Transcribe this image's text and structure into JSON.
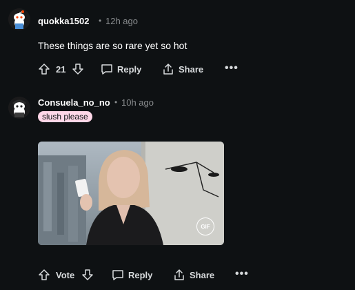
{
  "comments": [
    {
      "username": "quokka1502",
      "dot": "•",
      "timestamp": "12h ago",
      "text": "These things are so rare yet so hot",
      "votes": "21",
      "reply_label": "Reply",
      "share_label": "Share",
      "more_label": "•••"
    },
    {
      "username": "Consuela_no_no",
      "dot": "•",
      "timestamp": "10h ago",
      "flair": "slush please",
      "gif_badge": "GIF",
      "votes": "Vote",
      "reply_label": "Reply",
      "share_label": "Share",
      "more_label": "•••"
    }
  ],
  "colors": {
    "background": "#0e1113",
    "text_primary": "#ffffff",
    "text_secondary": "#8a8d8f",
    "flair_bg": "#ffd7e8"
  },
  "icons": [
    "reddit-snoo-avatar",
    "upvote-icon",
    "downvote-icon",
    "reply-icon",
    "share-icon",
    "more-options-icon",
    "gif-badge-icon"
  ]
}
